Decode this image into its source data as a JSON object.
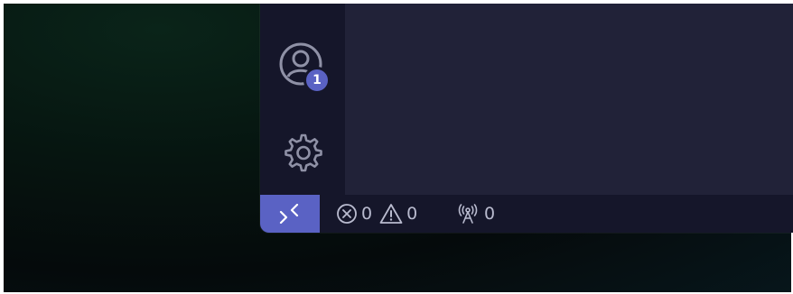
{
  "activity_bar": {
    "accounts_icon": "account-circle-icon",
    "accounts_badge": "1",
    "settings_icon": "gear-icon"
  },
  "status_bar": {
    "remote_icon": "remote-indicator-icon",
    "errors_icon": "error-circle-icon",
    "errors_count": "0",
    "warnings_icon": "warning-triangle-icon",
    "warnings_count": "0",
    "ports_icon": "broadcast-antenna-icon",
    "ports_count": "0"
  },
  "colors": {
    "accent": "#5a62c4",
    "activity_bar_bg": "#15162a",
    "editor_bg": "#212238",
    "status_text": "#b9bbcf"
  }
}
